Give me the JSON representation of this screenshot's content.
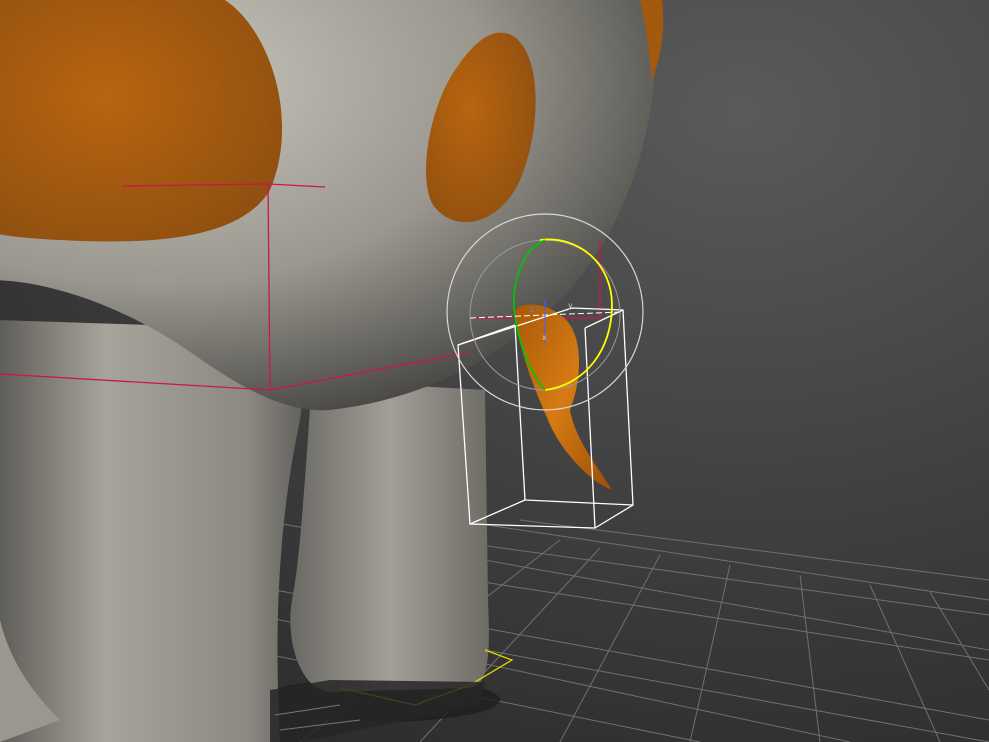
{
  "viewport": {
    "background_top": "#555555",
    "background_bottom": "#2a2a2a",
    "grid_color": "#6f6f6f"
  },
  "scene": {
    "body_color": "#8f8d86",
    "body_highlight": "#bdbab2",
    "spot_color": "#b86614",
    "tail_color": "#c8700f",
    "bounding_box_color": "#c8184a",
    "selection_box_color": "#ffffff",
    "floor_box_color": "#e8d400"
  },
  "gizmo": {
    "ring_outer_color": "#d8d8d8",
    "ring_x_color": "#ffff00",
    "ring_y_color": "#00c800",
    "axis_labels": [
      "z",
      "y",
      "x"
    ]
  }
}
